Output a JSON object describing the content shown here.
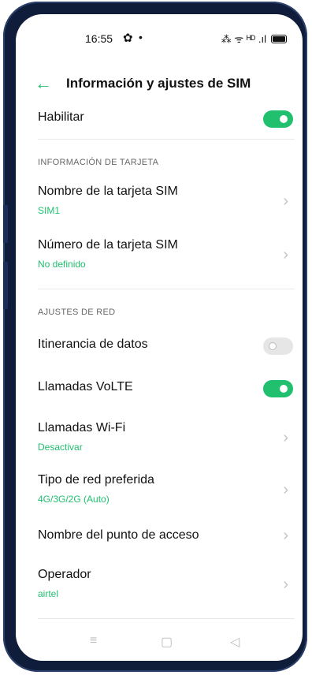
{
  "status": {
    "time": "16:55",
    "gear": "✿",
    "dot": "•",
    "right_icons": "⁂ ᯤ ᴴᴰ .ıl"
  },
  "header": {
    "title": "Información y ajustes de SIM"
  },
  "enable": {
    "label": "Habilitar",
    "state": "on"
  },
  "card_info": {
    "section": "INFORMACIÓN DE TARJETA",
    "items": [
      {
        "label": "Nombre de la tarjeta SIM",
        "value": "SIM1"
      },
      {
        "label": "Número de la tarjeta SIM",
        "value": "No definido"
      }
    ]
  },
  "network": {
    "section": "AJUSTES DE RED",
    "roaming": {
      "label": "Itinerancia de datos",
      "state": "off"
    },
    "volte": {
      "label": "Llamadas VoLTE",
      "state": "on"
    },
    "items": [
      {
        "label": "Llamadas Wi-Fi",
        "value": "Desactivar"
      },
      {
        "label": "Tipo de red preferida",
        "value": "4G/3G/2G (Auto)"
      },
      {
        "label": "Nombre del punto de acceso",
        "value": ""
      },
      {
        "label": "Operador",
        "value": "airtel"
      }
    ]
  },
  "colors": {
    "accent": "#20c06e",
    "accent_text": "#1fbf6f"
  }
}
